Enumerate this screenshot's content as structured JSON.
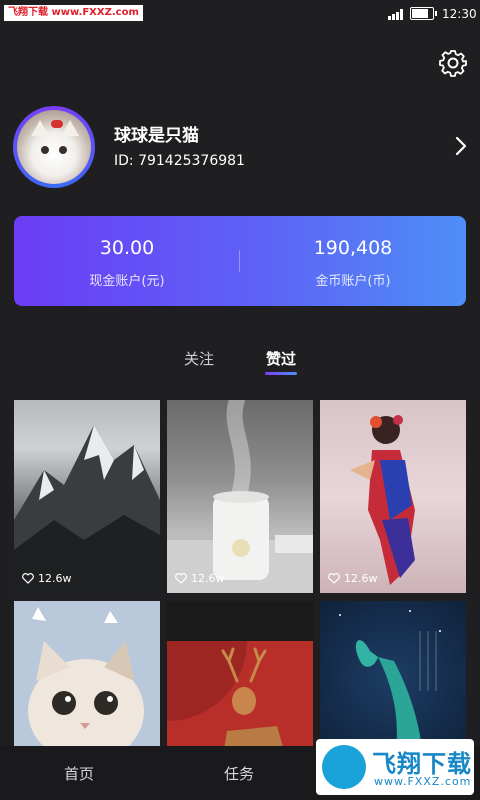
{
  "status_bar": {
    "watermark": "飞翔下载 www.FXXZ.com",
    "time": "12:30",
    "battery_level": 0.85
  },
  "profile": {
    "name": "球球是只猫",
    "id_text": "ID:  791425376981"
  },
  "accounts": {
    "cash": {
      "value": "30.00",
      "label": "现金账户(元)"
    },
    "coins": {
      "value": "190,408",
      "label": "金币账户(币)"
    }
  },
  "tabs": [
    {
      "label": "关注",
      "active": false
    },
    {
      "label": "赞过",
      "active": true
    }
  ],
  "grid": {
    "items": [
      {
        "likes": "12.6w",
        "subject": "snowy mountain"
      },
      {
        "likes": "12.6w",
        "subject": "humidifier"
      },
      {
        "likes": "12.6w",
        "subject": "fashion model"
      },
      {
        "subject": "cat"
      },
      {
        "subject": "deer"
      },
      {
        "subject": "whale illustration"
      }
    ]
  },
  "bottom_nav": {
    "items": [
      {
        "label": "首页"
      },
      {
        "label": "任务"
      }
    ]
  },
  "watermark_badge": {
    "title": "飞翔下载",
    "url": "www.FXXZ.com"
  },
  "colors": {
    "accent_start": "#6b3df5",
    "accent_end": "#4f8ef7",
    "background": "#1f1f21"
  }
}
